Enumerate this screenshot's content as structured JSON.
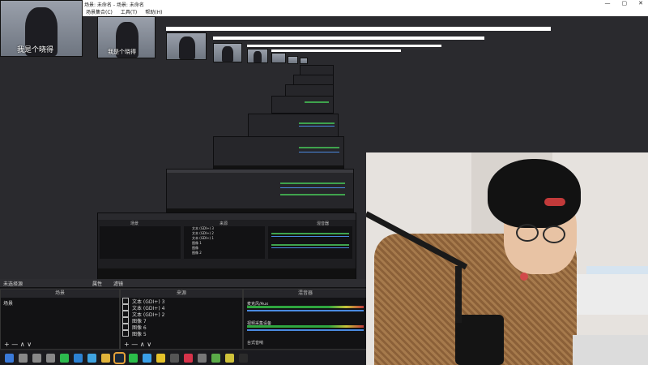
{
  "window": {
    "title": "场景: 未命名 - 场景: 未命名",
    "controls": [
      "—",
      "▢",
      "✕"
    ]
  },
  "menu": [
    "场景集合(C)",
    "工具(T)",
    "帮助(H)"
  ],
  "thumbnails": [
    {
      "caption": "我是个晓得"
    },
    {
      "caption": "我是个晓得"
    }
  ],
  "mid_panel": {
    "scene_label": "场景",
    "sources_label": "来源",
    "mixer_label": "混音器",
    "sources": [
      "文本 (GDI+) 3",
      "文本 (GDI+) 2",
      "文本 (GDI+) 1",
      "图像 1",
      "图像",
      "图像 2"
    ]
  },
  "dock": {
    "header": "未选择源",
    "props_button": "属性",
    "filters_button": "滤镜",
    "scenes_header": "场景",
    "sources_header": "来源",
    "mixer_header": "混音器",
    "scene_item": "场景",
    "sources": [
      {
        "label": "文本 (GDI+) 3",
        "icon": "text-icon"
      },
      {
        "label": "文本 (GDI+) 4",
        "icon": "text-icon"
      },
      {
        "label": "文本 (GDI+) 2",
        "icon": "text-icon"
      },
      {
        "label": "图像 7",
        "icon": "image-icon"
      },
      {
        "label": "图像 6",
        "icon": "image-icon"
      },
      {
        "label": "图像 5",
        "icon": "image-icon"
      }
    ],
    "mixer": [
      {
        "label": "麦克风/Aux"
      },
      {
        "label": "视频采集设备"
      },
      {
        "label": "台式音响"
      }
    ],
    "controls": "+  —  ∧  ∨"
  },
  "taskbar": {
    "icons": [
      {
        "name": "windows-start-icon",
        "color": "#3a7ad9"
      },
      {
        "name": "search-icon",
        "color": "#888888"
      },
      {
        "name": "task-view-icon",
        "color": "#888888"
      },
      {
        "name": "grid-app-icon",
        "color": "#888888"
      },
      {
        "name": "wechat-icon",
        "color": "#2dba4e"
      },
      {
        "name": "edge-icon",
        "color": "#2c82d3"
      },
      {
        "name": "chat-icon",
        "color": "#3fa3e0"
      },
      {
        "name": "folder-icon",
        "color": "#e0b33a"
      },
      {
        "name": "steam-icon",
        "color": "#1b2838"
      },
      {
        "name": "qq-icon",
        "color": "#2bbd4a"
      },
      {
        "name": "browser-icon",
        "color": "#3aa0e8"
      },
      {
        "name": "clock-icon",
        "color": "#e5c22a"
      },
      {
        "name": "game-icon",
        "color": "#555555"
      },
      {
        "name": "netease-icon",
        "color": "#d6334a"
      },
      {
        "name": "monitor-icon",
        "color": "#777777"
      },
      {
        "name": "mail-icon",
        "color": "#5aaa48"
      },
      {
        "name": "app2-icon",
        "color": "#cfc23a"
      },
      {
        "name": "obs-icon",
        "color": "#2b2b2b"
      }
    ]
  }
}
